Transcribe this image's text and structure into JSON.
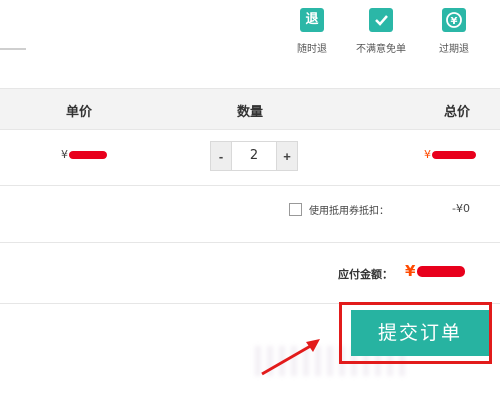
{
  "guarantees": [
    {
      "icon": "return-icon",
      "glyph": "退",
      "label": "随时退"
    },
    {
      "icon": "check-icon",
      "glyph": "✓",
      "label": "不满意免单"
    },
    {
      "icon": "clock-return-icon",
      "glyph": "¥",
      "label": "过期退"
    }
  ],
  "table": {
    "headers": {
      "unit_price": "单价",
      "quantity": "数量",
      "total": "总价"
    }
  },
  "item": {
    "unit_price_symbol": "¥",
    "quantity": "2",
    "total_symbol": "¥",
    "minus": "-",
    "plus": "+"
  },
  "coupon": {
    "label": "使用抵用券抵扣：",
    "amount": "-¥0"
  },
  "payable": {
    "label": "应付金额：",
    "symbol": "¥"
  },
  "submit": {
    "label": "提交订单"
  },
  "colors": {
    "accent": "#27b3a1",
    "price_red": "#ff4a00",
    "highlight": "#e21b1b"
  }
}
